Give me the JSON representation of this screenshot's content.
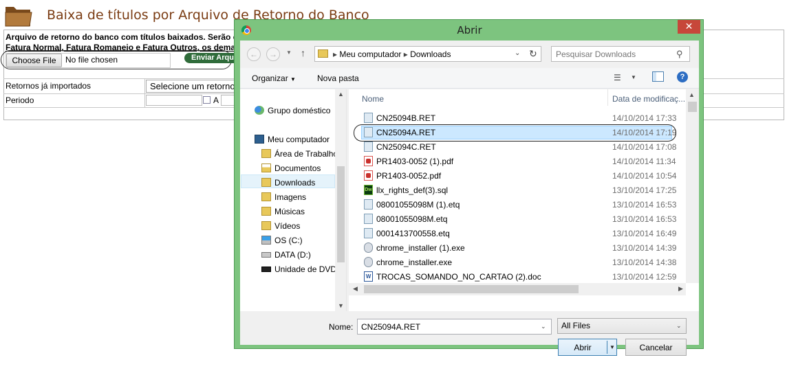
{
  "page": {
    "title": "Baixa de títulos por Arquivo de Retorno do Banco",
    "description_line1": "Arquivo de retorno do banco com títulos baixados. Serão c",
    "description_line2": "Fatura Normal, Fatura Romaneio e Fatura Outros, os dema",
    "choose_file_label": "Choose File",
    "no_file_label": "No file chosen",
    "enviar_label": "Enviar Arqui",
    "retornos_label": "Retornos já importados",
    "retornos_select_value": "Selecione um retorno",
    "periodo_label": "Periodo",
    "periodo_separator": "A"
  },
  "dialog": {
    "title": "Abrir",
    "close_label": "✕",
    "breadcrumb": [
      "Meu computador",
      "Downloads"
    ],
    "search_placeholder": "Pesquisar Downloads",
    "toolbar": {
      "organizar": "Organizar",
      "nova_pasta": "Nova pasta",
      "help": "?"
    },
    "nav_items": [
      {
        "label": "Grupo doméstico",
        "icon": "homegroup-icon"
      },
      {
        "label": "Meu computador",
        "icon": "computer-icon"
      },
      {
        "label": "Área de Trabalho",
        "icon": "folder-icon"
      },
      {
        "label": "Documentos",
        "icon": "folder-icon"
      },
      {
        "label": "Downloads",
        "icon": "folder-icon",
        "selected": true
      },
      {
        "label": "Imagens",
        "icon": "folder-icon"
      },
      {
        "label": "Músicas",
        "icon": "folder-icon"
      },
      {
        "label": "Vídeos",
        "icon": "folder-icon"
      },
      {
        "label": "OS (C:)",
        "icon": "windows-drive-icon"
      },
      {
        "label": "DATA (D:)",
        "icon": "drive-icon"
      },
      {
        "label": "Unidade de DVD-",
        "icon": "dvd-drive-icon"
      }
    ],
    "columns": {
      "name": "Nome",
      "date": "Data de modificaç..."
    },
    "files": [
      {
        "name": "CN25094B.RET",
        "date": "14/10/2014 17:33",
        "type": "ret"
      },
      {
        "name": "CN25094A.RET",
        "date": "14/10/2014 17:19",
        "type": "ret",
        "selected": true
      },
      {
        "name": "CN25094C.RET",
        "date": "14/10/2014 17:08",
        "type": "ret"
      },
      {
        "name": "PR1403-0052 (1).pdf",
        "date": "14/10/2014 11:34",
        "type": "pdf"
      },
      {
        "name": "PR1403-0052.pdf",
        "date": "14/10/2014 10:54",
        "type": "pdf"
      },
      {
        "name": "llx_rights_def(3).sql",
        "date": "13/10/2014 17:25",
        "type": "dw"
      },
      {
        "name": "08001055098M (1).etq",
        "date": "13/10/2014 16:53",
        "type": "ret"
      },
      {
        "name": "08001055098M.etq",
        "date": "13/10/2014 16:53",
        "type": "ret"
      },
      {
        "name": "0001413700558.etq",
        "date": "13/10/2014 16:49",
        "type": "ret"
      },
      {
        "name": "chrome_installer (1).exe",
        "date": "13/10/2014 14:39",
        "type": "exe"
      },
      {
        "name": "chrome_installer.exe",
        "date": "13/10/2014 14:38",
        "type": "exe"
      },
      {
        "name": "TROCAS_SOMANDO_NO_CARTAO (2).doc",
        "date": "13/10/2014 12:59",
        "type": "doc"
      }
    ],
    "nome_label": "Nome:",
    "nome_value": "CN25094A.RET",
    "type_value": "All Files",
    "abrir_label": "Abrir",
    "cancelar_label": "Cancelar"
  }
}
